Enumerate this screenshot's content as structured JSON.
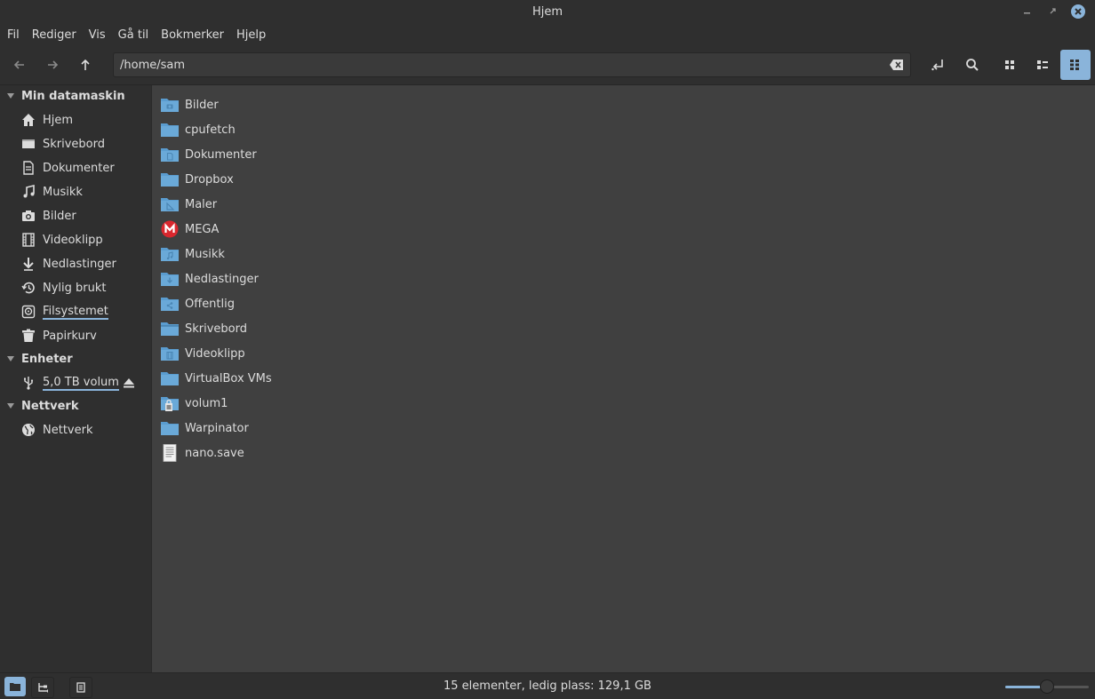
{
  "window": {
    "title": "Hjem"
  },
  "menu": [
    "Fil",
    "Rediger",
    "Vis",
    "Gå til",
    "Bokmerker",
    "Hjelp"
  ],
  "toolbar": {
    "path": "/home/sam",
    "icons": [
      "back-arrow-icon",
      "forward-arrow-icon",
      "up-arrow-icon",
      "toggle-location-icon",
      "search-icon",
      "icon-view-icon",
      "list-view-icon",
      "compact-view-icon"
    ],
    "active_view": "compact"
  },
  "sidebar": {
    "sections": [
      {
        "label": "Min datamaskin",
        "items": [
          {
            "label": "Hjem",
            "icon": "home-icon"
          },
          {
            "label": "Skrivebord",
            "icon": "desktop-icon"
          },
          {
            "label": "Dokumenter",
            "icon": "documents-icon"
          },
          {
            "label": "Musikk",
            "icon": "music-icon"
          },
          {
            "label": "Bilder",
            "icon": "camera-icon"
          },
          {
            "label": "Videoklipp",
            "icon": "film-icon"
          },
          {
            "label": "Nedlastinger",
            "icon": "download-icon"
          },
          {
            "label": "Nylig brukt",
            "icon": "history-icon"
          },
          {
            "label": "Filsystemet",
            "icon": "drive-icon"
          },
          {
            "label": "Papirkurv",
            "icon": "trash-icon"
          }
        ]
      },
      {
        "label": "Enheter",
        "items": [
          {
            "label": "5,0 TB volum",
            "icon": "usb-icon"
          }
        ]
      },
      {
        "label": "Nettverk",
        "items": [
          {
            "label": "Nettverk",
            "icon": "globe-icon"
          }
        ]
      }
    ]
  },
  "files": [
    {
      "name": "Bilder",
      "icon": "folder-pictures-icon"
    },
    {
      "name": "cpufetch",
      "icon": "folder-icon"
    },
    {
      "name": "Dokumenter",
      "icon": "folder-documents-icon"
    },
    {
      "name": "Dropbox",
      "icon": "folder-icon"
    },
    {
      "name": "Maler",
      "icon": "folder-templates-icon"
    },
    {
      "name": "MEGA",
      "icon": "mega-icon"
    },
    {
      "name": "Musikk",
      "icon": "folder-music-icon"
    },
    {
      "name": "Nedlastinger",
      "icon": "folder-download-icon"
    },
    {
      "name": "Offentlig",
      "icon": "folder-public-icon"
    },
    {
      "name": "Skrivebord",
      "icon": "folder-desktop-icon"
    },
    {
      "name": "Videoklipp",
      "icon": "folder-videos-icon"
    },
    {
      "name": "VirtualBox VMs",
      "icon": "folder-icon"
    },
    {
      "name": "volum1",
      "icon": "folder-locked-icon"
    },
    {
      "name": "Warpinator",
      "icon": "folder-icon"
    },
    {
      "name": "nano.save",
      "icon": "text-file-icon"
    }
  ],
  "status": {
    "text": "15 elementer, ledig plass: 129,1 GB",
    "zoom_level": 0.5
  },
  "colors": {
    "accent": "#8ab4da",
    "folder": "#6aa9d8",
    "mega_red": "#d9272e"
  }
}
